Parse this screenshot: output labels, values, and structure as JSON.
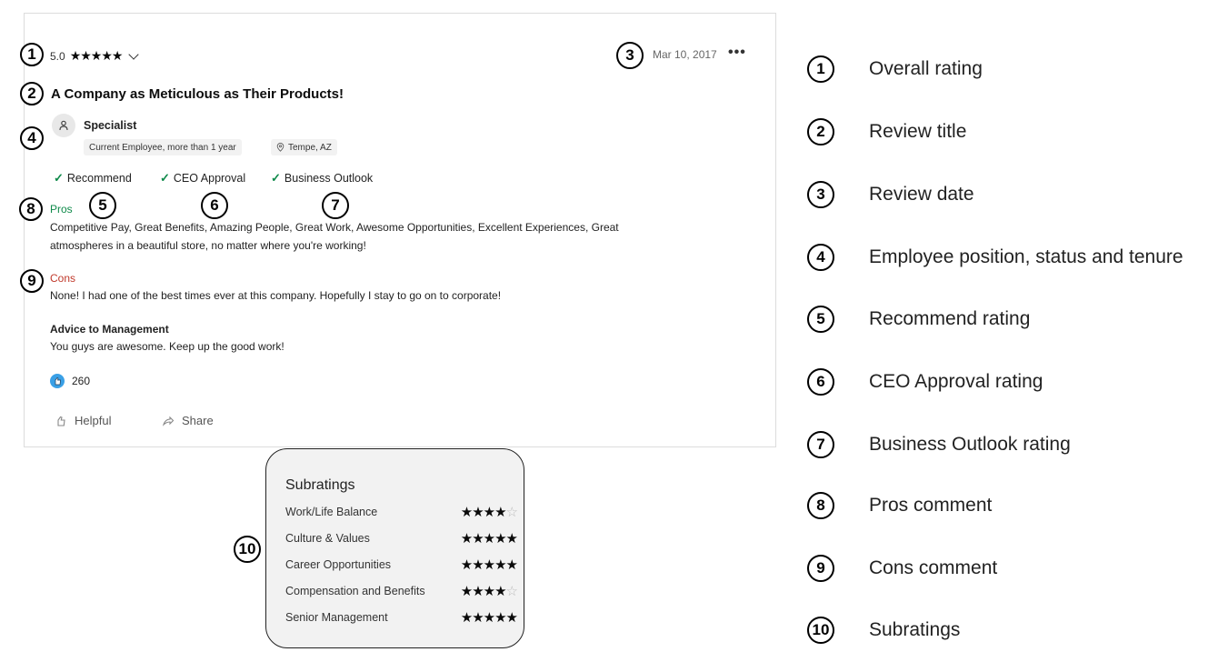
{
  "review": {
    "overall_rating": "5.0",
    "overall_stars": "★★★★★",
    "date": "Mar 10, 2017",
    "menu_dots": "•••",
    "title": "A Company as Meticulous as Their Products!",
    "position": "Specialist",
    "status_tag": "Current Employee, more than 1 year",
    "location_tag": "Tempe, AZ",
    "recommend": "Recommend",
    "ceo_approval": "CEO Approval",
    "business_outlook": "Business Outlook",
    "check_glyph": "✓",
    "pros_heading": "Pros",
    "pros_line1": "Competitive Pay, Great Benefits, Amazing People, Great Work, Awesome Opportunities, Excellent Experiences, Great",
    "pros_line2": "atmospheres in a beautiful store, no matter where you're working!",
    "cons_heading": "Cons",
    "cons_text": "None! I had one of the best times ever at this company. Hopefully I stay to go on to corporate!",
    "advice_heading": "Advice to Management",
    "advice_text": "You guys are awesome. Keep up the good work!",
    "helpful_count": "260",
    "helpful_label": "Helpful",
    "share_label": "Share"
  },
  "subratings": {
    "title": "Subratings",
    "items": [
      {
        "label": "Work/Life Balance",
        "filled": "★★★★",
        "empty": "☆",
        "rating": 4
      },
      {
        "label": "Culture & Values",
        "filled": "★★★★★",
        "empty": "",
        "rating": 5
      },
      {
        "label": "Career Opportunities",
        "filled": "★★★★★",
        "empty": "",
        "rating": 5
      },
      {
        "label": "Compensation and Benefits",
        "filled": "★★★★",
        "empty": "☆",
        "rating": 4
      },
      {
        "label": "Senior Management",
        "filled": "★★★★★",
        "empty": "",
        "rating": 5
      }
    ]
  },
  "markers": [
    "1",
    "2",
    "3",
    "4",
    "5",
    "6",
    "7",
    "8",
    "9",
    "10"
  ],
  "legend": [
    {
      "num": "1",
      "label": "Overall rating"
    },
    {
      "num": "2",
      "label": "Review title"
    },
    {
      "num": "3",
      "label": "Review date"
    },
    {
      "num": "4",
      "label": "Employee position, status and tenure"
    },
    {
      "num": "5",
      "label": "Recommend rating"
    },
    {
      "num": "6",
      "label": "CEO Approval rating"
    },
    {
      "num": "7",
      "label": "Business Outlook rating"
    },
    {
      "num": "8",
      "label": "Pros comment"
    },
    {
      "num": "9",
      "label": "Cons comment"
    },
    {
      "num": "10",
      "label": "Subratings"
    }
  ],
  "colors": {
    "pros": "#0f8a4a",
    "cons": "#c0392b",
    "helpful_icon": "#3aa0e6"
  },
  "icons": [
    "chevron-down-icon",
    "more-dots-icon",
    "person-icon",
    "location-pin-icon",
    "check-icon",
    "helpful-hand-icon",
    "share-icon"
  ]
}
